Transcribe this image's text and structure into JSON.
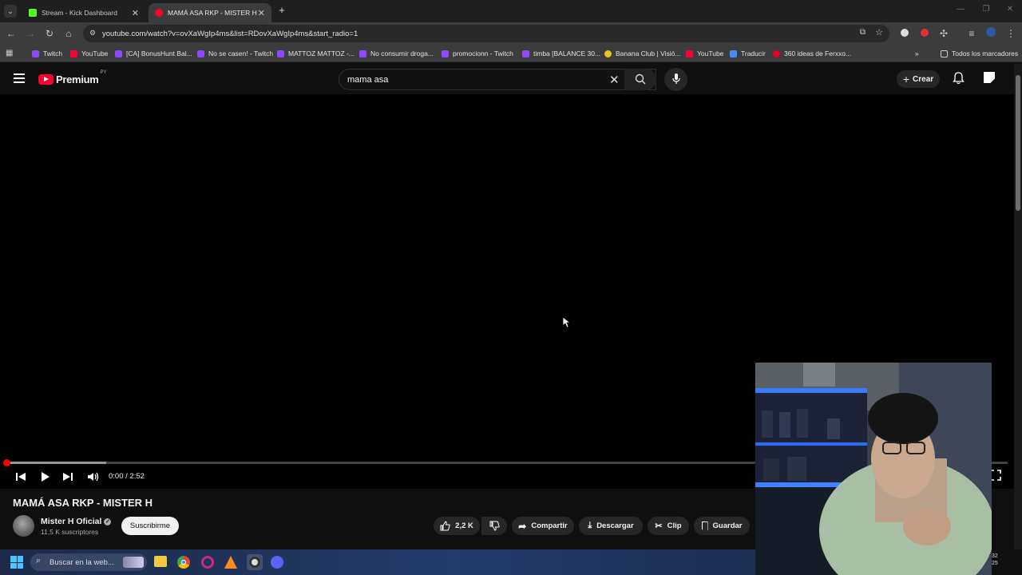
{
  "browser": {
    "tabs": [
      {
        "title": "Stream - Kick Dashboard",
        "favicon_color": "#53fc18",
        "active": false
      },
      {
        "title": "MAMÁ ASA RKP - MISTER H - ",
        "favicon_color": "#ff0033",
        "active": true
      }
    ],
    "url": "youtube.com/watch?v=ovXaWgIp4ms&list=RDovXaWgIp4ms&start_radio=1",
    "bookmarks": [
      {
        "label": "Twitch",
        "color": "#9146ff"
      },
      {
        "label": "YouTube",
        "color": "#ff0033"
      },
      {
        "label": "[CA] BonusHunt Bal...",
        "color": "#9146ff"
      },
      {
        "label": "No se casen! - Twitch",
        "color": "#9146ff"
      },
      {
        "label": "MATTOZ MATTOZ -...",
        "color": "#9146ff"
      },
      {
        "label": "No consumir droga...",
        "color": "#9146ff"
      },
      {
        "label": "promocionn - Twitch",
        "color": "#9146ff"
      },
      {
        "label": "timba [BALANCE 30...",
        "color": "#9146ff"
      },
      {
        "label": "Banana Club | Visió...",
        "color": "#e8c21a"
      },
      {
        "label": "YouTube",
        "color": "#ff0033"
      },
      {
        "label": "Traducir",
        "color": "#4a8af4"
      },
      {
        "label": "360 ideas de Ferxxo...",
        "color": "#e60023"
      }
    ],
    "all_bookmarks_label": "Todos los marcadores"
  },
  "youtube": {
    "logo_text": "Premium",
    "country_code": "PY",
    "search_value": "mama asa",
    "create_label": "Crear"
  },
  "player": {
    "time": "0:00 / 2:52",
    "progress_fraction": 0.0,
    "buffered_fraction": 0.1
  },
  "video": {
    "title": "MAMÁ ASA RKP - MISTER H",
    "channel": "Mister H Oficial",
    "subscribers": "11,5 K suscriptores",
    "subscribe_label": "Suscribirme",
    "likes": "2,2 K",
    "share_label": "Compartir",
    "download_label": "Descargar",
    "clip_label": "Clip",
    "save_label": "Guardar"
  },
  "taskbar": {
    "search_placeholder": "Buscar en la web...",
    "clock_partial": "32\n25"
  }
}
